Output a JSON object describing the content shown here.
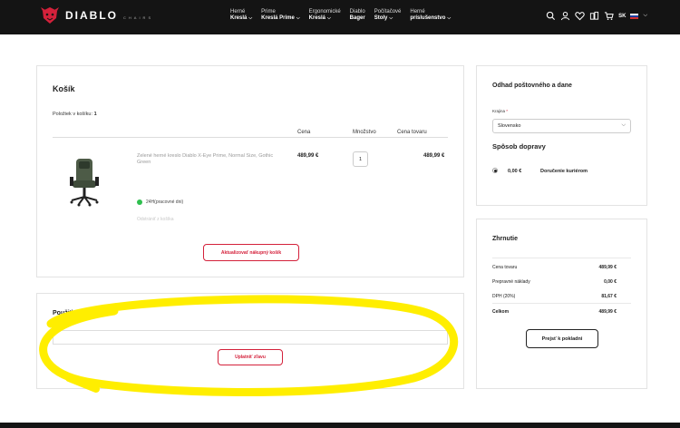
{
  "header": {
    "logo_text": "DIABLO",
    "logo_sub": "CHAIRS",
    "nav": [
      {
        "line1": "Herné",
        "line2": "Kreslá"
      },
      {
        "line1": "Prime",
        "line2": "Kreslá Prime"
      },
      {
        "line1": "Ergonomické",
        "line2": "Kreslá"
      },
      {
        "line1": "Diablo",
        "line2": "Bager"
      },
      {
        "line1": "Počítačové",
        "line2": "Stoly"
      },
      {
        "line1": "Herné",
        "line2": "príslušenstvo"
      }
    ],
    "lang": "SK",
    "icons": [
      "search-icon",
      "user-icon",
      "heart-icon",
      "compare-icon",
      "cart-icon",
      "flag-sk-icon"
    ]
  },
  "cart": {
    "title": "Košík",
    "count_label": "Položiek v košíku:",
    "count": "1",
    "columns": {
      "price": "Cena",
      "quantity": "Množstvo",
      "total": "Cena tovaru"
    },
    "item": {
      "name": "Zelené herné kreslo Diablo X-Eye Prime, Normal Size, Gothic Green",
      "price": "489,99 €",
      "quantity": "1",
      "total": "489,99 €",
      "stock": "24H(pracovné dni)",
      "remove": "Odstrániť z košíka"
    },
    "update_button": "Aktualizovať nákupný košík"
  },
  "coupon": {
    "title": "Použiť zľavový kód",
    "input_value": "",
    "apply_button": "Uplatniť zľavu"
  },
  "shipping": {
    "title": "Odhad poštovného a dane",
    "region_label": "Krajina",
    "region_required": "*",
    "region_value": "Slovensko",
    "delivery_title": "Spôsob dopravy",
    "option_price": "0,00 €",
    "option_name": "Doručenie kuriérom"
  },
  "summary": {
    "title": "Zhrnutie",
    "rows": [
      {
        "label": "Cena tovaru",
        "value": "489,99 €"
      },
      {
        "label": "Prepravné náklady",
        "value": "0,00 €"
      },
      {
        "label": "DPH (20%)",
        "value": "81,67 €"
      },
      {
        "label": "Celkom",
        "value": "489,99 €"
      }
    ],
    "checkout_button": "Prejsť k pokladni"
  },
  "colors": {
    "brand_red": "#d4213b",
    "header_bg": "#141414",
    "highlight": "#ffee00",
    "stock_green": "#2fbf4f"
  }
}
